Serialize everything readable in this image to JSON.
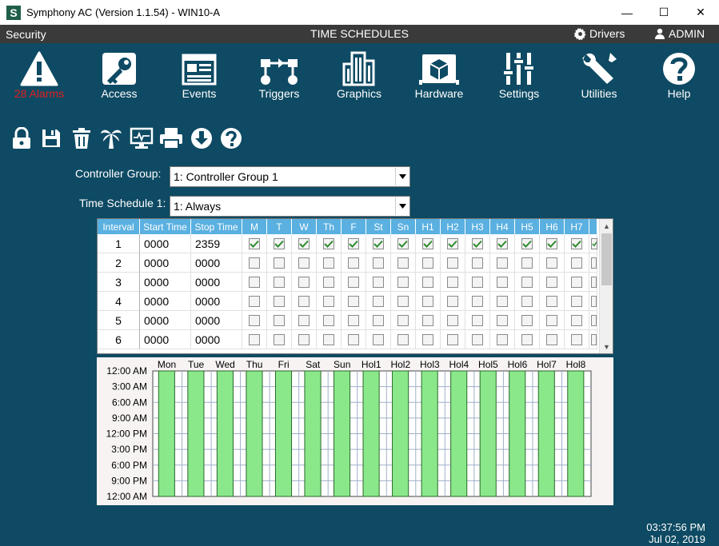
{
  "window": {
    "title": "Symphony AC  (Version 1.1.54) - WIN10-A",
    "logo_letter": "S",
    "minimize": "—",
    "maximize": "☐",
    "close": "✕"
  },
  "menubar": {
    "security": "Security",
    "page_title": "TIME SCHEDULES",
    "drivers": "Drivers",
    "admin": "ADMIN"
  },
  "nav": {
    "alarms": "28 Alarms",
    "access": "Access",
    "events": "Events",
    "triggers": "Triggers",
    "graphics": "Graphics",
    "hardware": "Hardware",
    "settings": "Settings",
    "utilities": "Utilities",
    "help": "Help"
  },
  "toolbar_icons": [
    "lock-icon",
    "save-icon",
    "trash-icon",
    "palm-tree-icon",
    "monitor-icon",
    "printer-icon",
    "download-icon",
    "help-icon"
  ],
  "form": {
    "controller_group_label": "Controller Group:",
    "controller_group_value": "1:  Controller Group 1",
    "time_schedule_label": "Time Schedule 1:",
    "time_schedule_value": "1:  Always"
  },
  "grid": {
    "headers": [
      "Interval",
      "Start Time",
      "Stop Time",
      "M",
      "T",
      "W",
      "Th",
      "F",
      "St",
      "Sn",
      "H1",
      "H2",
      "H3",
      "H4",
      "H5",
      "H6",
      "H7"
    ],
    "rows": [
      {
        "interval": "1",
        "start": "0000",
        "stop": "2359",
        "days": [
          true,
          true,
          true,
          true,
          true,
          true,
          true,
          true,
          true,
          true,
          true,
          true,
          true,
          true,
          true
        ]
      },
      {
        "interval": "2",
        "start": "0000",
        "stop": "0000",
        "days": [
          false,
          false,
          false,
          false,
          false,
          false,
          false,
          false,
          false,
          false,
          false,
          false,
          false,
          false,
          false
        ]
      },
      {
        "interval": "3",
        "start": "0000",
        "stop": "0000",
        "days": [
          false,
          false,
          false,
          false,
          false,
          false,
          false,
          false,
          false,
          false,
          false,
          false,
          false,
          false,
          false
        ]
      },
      {
        "interval": "4",
        "start": "0000",
        "stop": "0000",
        "days": [
          false,
          false,
          false,
          false,
          false,
          false,
          false,
          false,
          false,
          false,
          false,
          false,
          false,
          false,
          false
        ]
      },
      {
        "interval": "5",
        "start": "0000",
        "stop": "0000",
        "days": [
          false,
          false,
          false,
          false,
          false,
          false,
          false,
          false,
          false,
          false,
          false,
          false,
          false,
          false,
          false
        ]
      },
      {
        "interval": "6",
        "start": "0000",
        "stop": "0000",
        "days": [
          false,
          false,
          false,
          false,
          false,
          false,
          false,
          false,
          false,
          false,
          false,
          false,
          false,
          false,
          false
        ]
      }
    ]
  },
  "schedule_chart": {
    "type": "bar",
    "days": [
      "Mon",
      "Tue",
      "Wed",
      "Thu",
      "Fri",
      "Sat",
      "Sun",
      "Hol1",
      "Hol2",
      "Hol3",
      "Hol4",
      "Hol5",
      "Hol6",
      "Hol7",
      "Hol8"
    ],
    "time_labels": [
      "12:00 AM",
      "3:00 AM",
      "6:00 AM",
      "9:00 AM",
      "12:00 PM",
      "3:00 PM",
      "6:00 PM",
      "9:00 PM",
      "12:00 AM"
    ],
    "active_start_hour": 0,
    "active_end_hour": 24,
    "bar_color": "#8ae88a",
    "bar_border": "#2a6a2a"
  },
  "footer": {
    "time": "03:37:56 PM",
    "date": "Jul 02, 2019"
  },
  "colors": {
    "background": "#0e4a63",
    "header_blue": "#5ab0e0",
    "alarm_red": "#e02020",
    "check_green": "#2e8b2e"
  }
}
